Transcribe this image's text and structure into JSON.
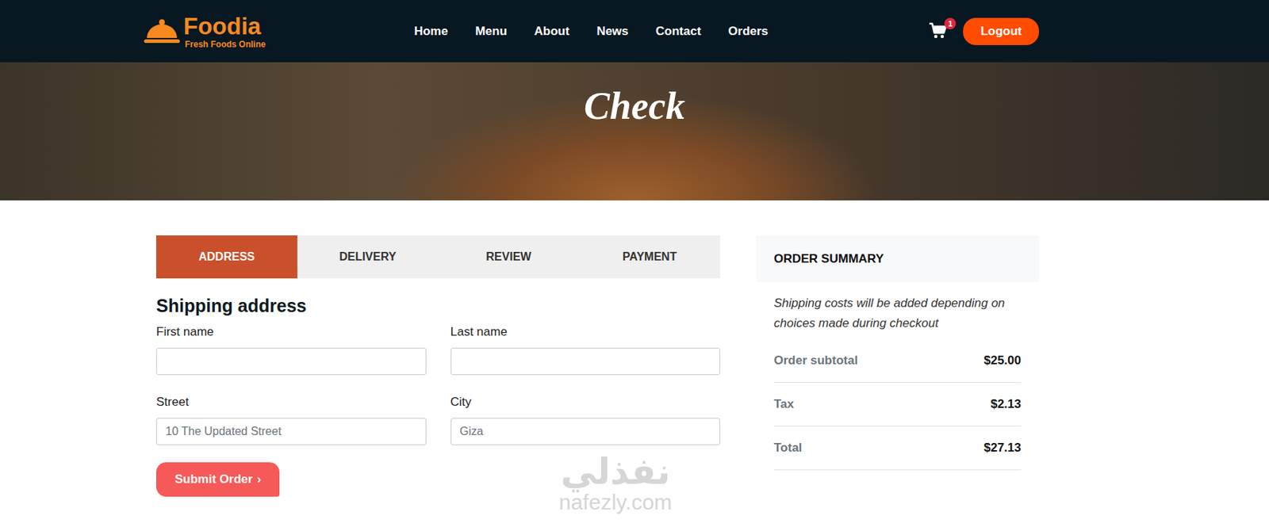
{
  "brand": {
    "name": "Foodia",
    "tagline": "Fresh Foods Online"
  },
  "nav": [
    "Home",
    "Menu",
    "About",
    "News",
    "Contact",
    "Orders"
  ],
  "cart": {
    "count": "1"
  },
  "logout": "Logout",
  "hero": {
    "title": "Check"
  },
  "steps": [
    {
      "label": "ADDRESS",
      "selected": true
    },
    {
      "label": "DELIVERY",
      "selected": false
    },
    {
      "label": "REVIEW",
      "selected": false
    },
    {
      "label": "PAYMENT",
      "selected": false
    }
  ],
  "form": {
    "title": "Shipping address",
    "fields": [
      {
        "label": "First name",
        "placeholder": ""
      },
      {
        "label": "Last name",
        "placeholder": ""
      },
      {
        "label": "Street",
        "placeholder": "10 The Updated Street"
      },
      {
        "label": "City",
        "placeholder": "Giza"
      }
    ],
    "submit": {
      "label": "Submit Order",
      "arrow": "›"
    }
  },
  "summary": {
    "title": "ORDER SUMMARY",
    "note": "Shipping costs will be added depending on choices made during checkout",
    "rows": [
      {
        "label": "Order subtotal",
        "value": "$25.00"
      },
      {
        "label": "Tax",
        "value": "$2.13"
      },
      {
        "label": "Total",
        "value": "$27.13"
      }
    ]
  },
  "watermark": {
    "arabic": "نفذلي",
    "latin": "nafezly.com"
  }
}
